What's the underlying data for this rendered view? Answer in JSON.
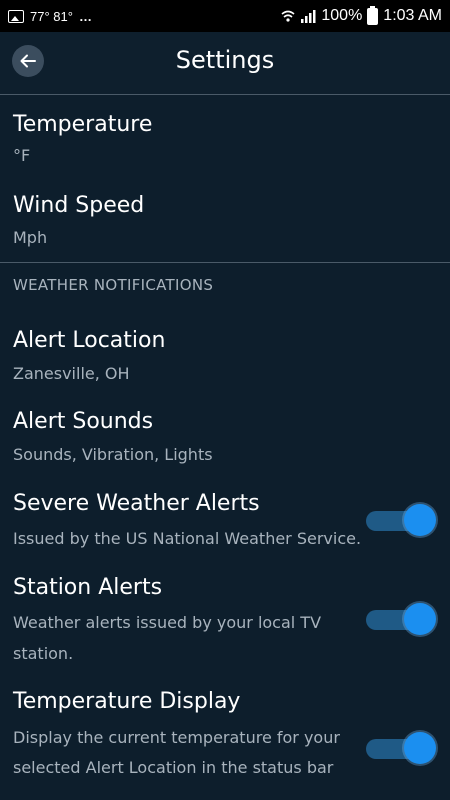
{
  "status_bar": {
    "temps": "77° 81°",
    "more": "…",
    "battery": "100%",
    "time": "1:03 AM"
  },
  "header": {
    "title": "Settings"
  },
  "settings": {
    "temperature": {
      "title": "Temperature",
      "value": "°F"
    },
    "wind_speed": {
      "title": "Wind Speed",
      "value": "Mph"
    },
    "section_title": "WEATHER NOTIFICATIONS",
    "alert_location": {
      "title": "Alert Location",
      "value": "Zanesville, OH"
    },
    "alert_sounds": {
      "title": "Alert Sounds",
      "value": "Sounds, Vibration, Lights"
    },
    "severe_weather": {
      "title": "Severe Weather Alerts",
      "desc": "Issued by the US National Weather Service.",
      "enabled": true
    },
    "station_alerts": {
      "title": "Station Alerts",
      "desc_line1": "Weather alerts issued by your local TV",
      "desc_line2": "station.",
      "enabled": true
    },
    "temperature_display": {
      "title": "Temperature Display",
      "desc_line1": "Display the current temperature for your",
      "desc_line2": "selected Alert Location in the status bar",
      "enabled": true
    }
  },
  "colors": {
    "background": "#0d1e2c",
    "accent": "#1b8ff0",
    "toggle_track": "#1f5a86",
    "secondary_text": "#a8b3bd"
  },
  "icons": [
    "image-icon",
    "wifi-icon",
    "signal-icon",
    "battery-icon",
    "back-arrow-icon"
  ]
}
